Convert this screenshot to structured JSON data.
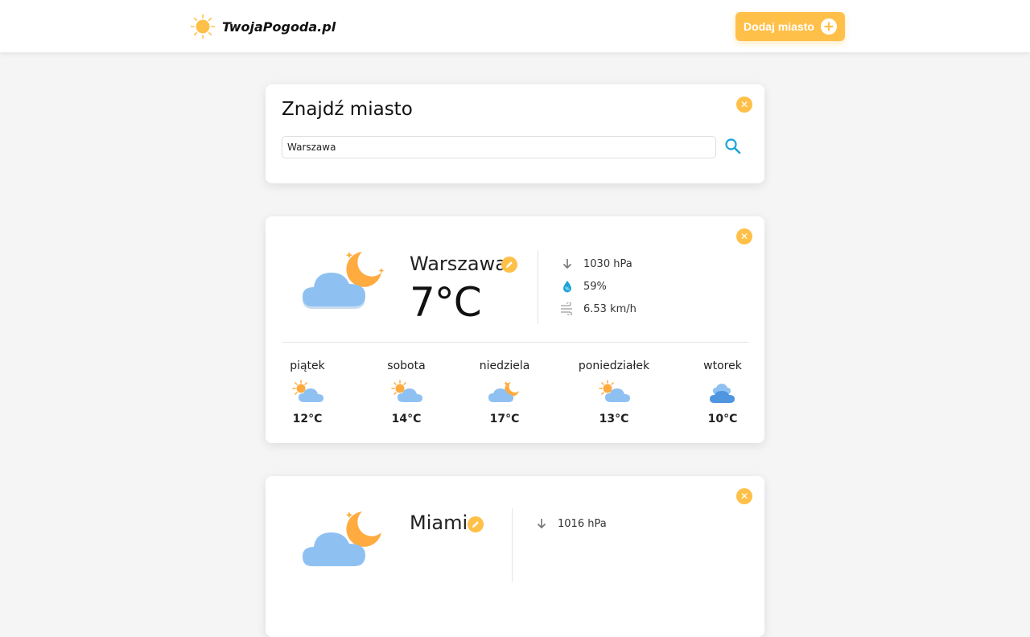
{
  "header": {
    "logo_text": "TwojaPogoda.pl",
    "add_city_label": "Dodaj miasto"
  },
  "search": {
    "title": "Znajdź miasto",
    "input_value": "Warszawa"
  },
  "cities": [
    {
      "name": "Warszawa",
      "temperature": "7°C",
      "pressure": "1030 hPa",
      "humidity": "59%",
      "wind": "6.53 km/h",
      "condition_icon": "cloud-moon-icon",
      "forecast": [
        {
          "day": "piątek",
          "temp": "12°C",
          "icon": "partly-sunny-icon"
        },
        {
          "day": "sobota",
          "temp": "14°C",
          "icon": "partly-sunny-icon"
        },
        {
          "day": "niedziela",
          "temp": "17°C",
          "icon": "partly-sunny-icon"
        },
        {
          "day": "poniedziałek",
          "temp": "13°C",
          "icon": "partly-sunny-icon"
        },
        {
          "day": "wtorek",
          "temp": "10°C",
          "icon": "rain-cloud-icon"
        }
      ]
    },
    {
      "name": "Miami",
      "pressure": "1016 hPa",
      "condition_icon": "cloud-moon-icon"
    }
  ],
  "colors": {
    "accent": "#ffc04a",
    "cloud": "#8ec1f2",
    "moon": "#ffab40",
    "search_icon": "#1ba3d9"
  }
}
